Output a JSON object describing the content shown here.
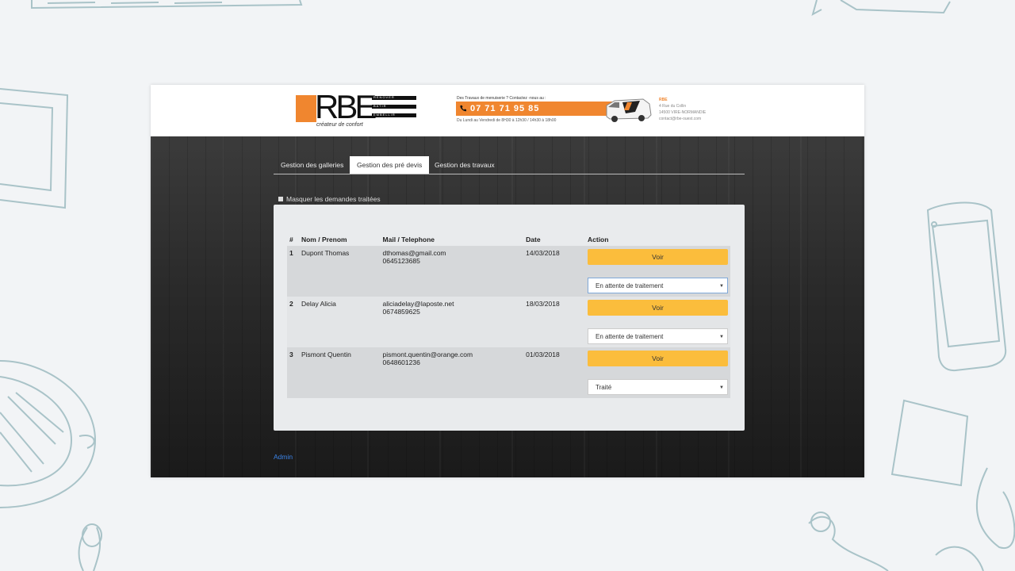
{
  "header": {
    "logo": {
      "letters": "RBE",
      "bars": [
        "RENOVER",
        "BATIR",
        "EMBELLIR"
      ],
      "tagline": "créateur de confort"
    },
    "banner": {
      "top": "Des Travaux de menuiserie ? Contactez -nous au :",
      "phone": "07 71 71 95 85",
      "bottom": "Du Lundi au Vendredi de 8H30 à 12h30 / 14h30 à 18h00",
      "phone_icon": "phone-icon",
      "van_icon": "van-icon"
    },
    "contact": {
      "name": "RBE",
      "address": "4 Rue du Collin",
      "city": "14500 VIRE-NORMANDIE",
      "email": "contact@rbe-ouest.com"
    }
  },
  "tabs": [
    {
      "label": "Gestion des galleries",
      "active": false
    },
    {
      "label": "Gestion des pré devis",
      "active": true
    },
    {
      "label": "Gestion des travaux",
      "active": false
    }
  ],
  "filter": {
    "label": "Masquer les demandes traitées"
  },
  "table": {
    "columns": [
      "#",
      "Nom / Prenom",
      "Mail / Telephone",
      "Date",
      "Action"
    ],
    "rows": [
      {
        "num": "1",
        "name": "Dupont Thomas",
        "email": "dthomas@gmail.com",
        "phone": "0645123685",
        "date": "14/03/2018",
        "button": "Voir",
        "status": "En attente de traitement"
      },
      {
        "num": "2",
        "name": "Delay Alicia",
        "email": "aliciadelay@laposte.net",
        "phone": "0674859625",
        "date": "18/03/2018",
        "button": "Voir",
        "status": "En attente de traitement"
      },
      {
        "num": "3",
        "name": "Pismont Quentin",
        "email": "pismont.quentin@orange.com",
        "phone": "0648601236",
        "date": "01/03/2018",
        "button": "Voir",
        "status": "Traité"
      }
    ]
  },
  "footer": {
    "admin_link": "Admin"
  },
  "colors": {
    "accent": "#f0862f",
    "button": "#fbbd3c",
    "link": "#3b83e6"
  }
}
